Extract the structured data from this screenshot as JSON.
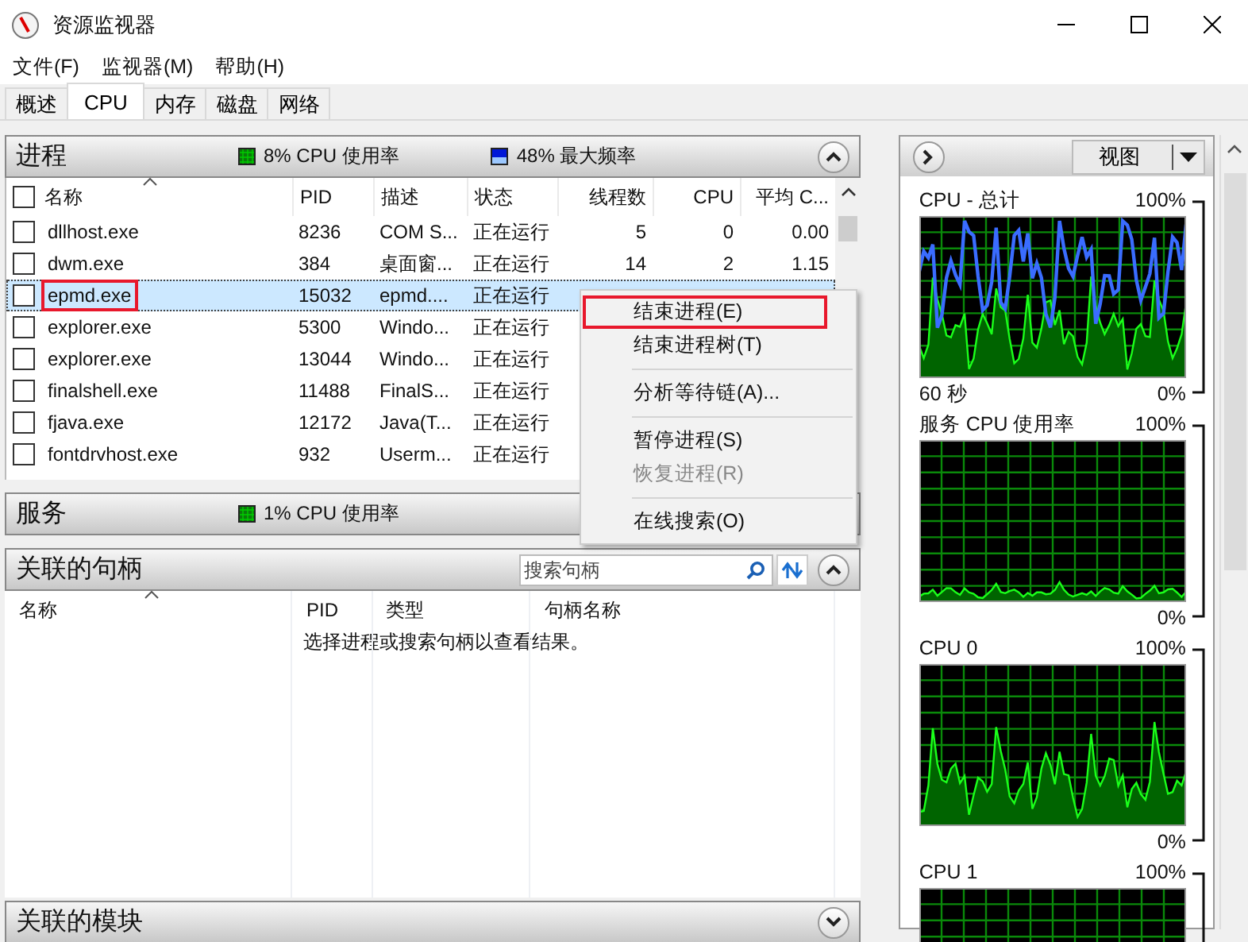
{
  "window": {
    "title": "资源监视器"
  },
  "menu": [
    "文件(F)",
    "监视器(M)",
    "帮助(H)"
  ],
  "tabs": [
    {
      "label": "概述",
      "selected": false
    },
    {
      "label": "CPU",
      "selected": true
    },
    {
      "label": "内存",
      "selected": false
    },
    {
      "label": "磁盘",
      "selected": false
    },
    {
      "label": "网络",
      "selected": false
    }
  ],
  "processes": {
    "title": "进程",
    "stats": [
      {
        "kind": "usage",
        "text": "8% CPU 使用率"
      },
      {
        "kind": "frequency",
        "text": "48% 最大频率"
      }
    ],
    "expanded": true,
    "header_checked": false,
    "columns": [
      "名称",
      "PID",
      "描述",
      "状态",
      "线程数",
      "CPU",
      "平均 C..."
    ],
    "rows": [
      {
        "name": "dllhost.exe",
        "pid": "8236",
        "description": "COM S...",
        "status": "正在运行",
        "threads": "5",
        "cpu": "0",
        "avg": "0.00",
        "checked": false,
        "selected": false,
        "highlighted": false
      },
      {
        "name": "dwm.exe",
        "pid": "384",
        "description": "桌面窗...",
        "status": "正在运行",
        "threads": "14",
        "cpu": "2",
        "avg": "1.15",
        "checked": false,
        "selected": false,
        "highlighted": false
      },
      {
        "name": "epmd.exe",
        "pid": "15032",
        "description": "epmd....",
        "status": "正在运行",
        "checked": false,
        "selected": true,
        "highlighted": true
      },
      {
        "name": "explorer.exe",
        "pid": "5300",
        "description": "Windo...",
        "status": "正在运行",
        "checked": false,
        "selected": false,
        "highlighted": false
      },
      {
        "name": "explorer.exe",
        "pid": "13044",
        "description": "Windo...",
        "status": "正在运行",
        "checked": false,
        "selected": false,
        "highlighted": false
      },
      {
        "name": "finalshell.exe",
        "pid": "11488",
        "description": "FinalS...",
        "status": "正在运行",
        "checked": false,
        "selected": false,
        "highlighted": false
      },
      {
        "name": "fjava.exe",
        "pid": "12172",
        "description": "Java(T...",
        "status": "正在运行",
        "checked": false,
        "selected": false,
        "highlighted": false
      },
      {
        "name": "fontdrvhost.exe",
        "pid": "932",
        "description": "Userm...",
        "status": "正在运行",
        "checked": false,
        "selected": false,
        "highlighted": false
      }
    ]
  },
  "services": {
    "title": "服务",
    "stats": [
      {
        "kind": "usage",
        "text": "1% CPU 使用率"
      }
    ]
  },
  "handles": {
    "title": "关联的句柄",
    "expanded": true,
    "search": {
      "placeholder": "搜索句柄"
    },
    "columns": [
      "名称",
      "PID",
      "类型",
      "句柄名称"
    ],
    "message": "选择进程或搜索句柄以查看结果。"
  },
  "modules": {
    "title": "关联的模块",
    "expanded": false
  },
  "context_menu": [
    {
      "label": "结束进程(E)",
      "disabled": false,
      "highlighted": true
    },
    {
      "label": "结束进程树(T)",
      "disabled": false,
      "highlighted": false
    },
    {
      "kind": "separator"
    },
    {
      "label": "分析等待链(A)...",
      "disabled": false,
      "highlighted": false
    },
    {
      "kind": "separator"
    },
    {
      "label": "暂停进程(S)",
      "disabled": false,
      "highlighted": false
    },
    {
      "label": "恢复进程(R)",
      "disabled": true,
      "highlighted": false
    },
    {
      "kind": "separator"
    },
    {
      "label": "在线搜索(O)",
      "disabled": false,
      "highlighted": false
    }
  ],
  "view_button": {
    "label": "视图"
  },
  "graphs": [
    {
      "kind": "total",
      "title": "CPU - 总计",
      "max": "100%",
      "time": "60 秒",
      "min": "0%"
    },
    {
      "kind": "service",
      "title": "服务 CPU 使用率",
      "max": "100%",
      "min": "0%"
    },
    {
      "kind": "core",
      "title": "CPU 0",
      "max": "100%",
      "min": "0%"
    },
    {
      "kind": "core",
      "title": "CPU 1",
      "max": "100%"
    }
  ]
}
